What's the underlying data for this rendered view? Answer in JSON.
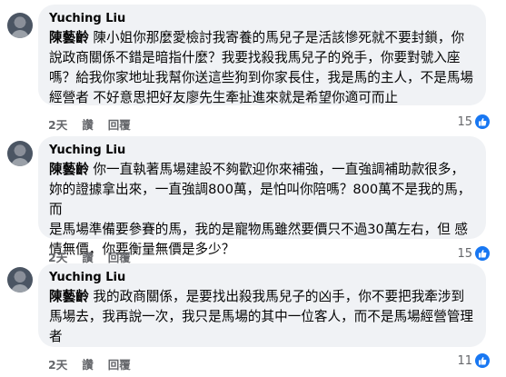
{
  "comments": [
    {
      "author": "Yuching Liu",
      "tag": "陳藝齡",
      "lines": [
        " 陳小姐你那麼愛檢討我寄養的馬兒子是活該慘死就不要封鎖，你",
        "說政商關係不錯是暗指什麼？我要找殺我馬兒子的兇手，你要對號入座",
        "嗎？給我你家地址我幫你送這些狗到你家長住，我是馬的主人，不是馬場",
        "經營者 不好意思把好友廖先生牽扯進來就是希望你適可而止"
      ],
      "time": "2天",
      "like": "讚",
      "reply": "回覆",
      "reaction_count": "15"
    },
    {
      "author": "Yuching Liu",
      "tag": "陳藝齡",
      "lines": [
        " 你一直執著馬場建設不夠歡迎你來補強，一直強調補助款很多，",
        "妳的證據拿出來，一直強調800萬，是怕叫你陪嗎？800萬不是我的馬，而",
        "是馬場準備要參賽的馬，我的是寵物馬雖然要價只不過30萬左右，但 感",
        "情無價，你要衡量無價是多少？"
      ],
      "time": "2天",
      "like": "讚",
      "reply": "回覆",
      "reaction_count": "15"
    },
    {
      "author": "Yuching Liu",
      "tag": "陳藝齡",
      "lines": [
        " 我的政商關係，是要找出殺我馬兒子的凶手，你不要把我牽涉到",
        "馬場去，我再說一次，我只是馬場的其中一位客人，而不是馬場經營管理",
        "者"
      ],
      "time": "2天",
      "like": "讚",
      "reply": "回覆",
      "reaction_count": "11"
    }
  ],
  "icons": {
    "reaction": "like-thumb-icon"
  },
  "colors": {
    "bubble": "#f0f2f5",
    "meta": "#65676b",
    "like_blue": "#1877f2"
  }
}
